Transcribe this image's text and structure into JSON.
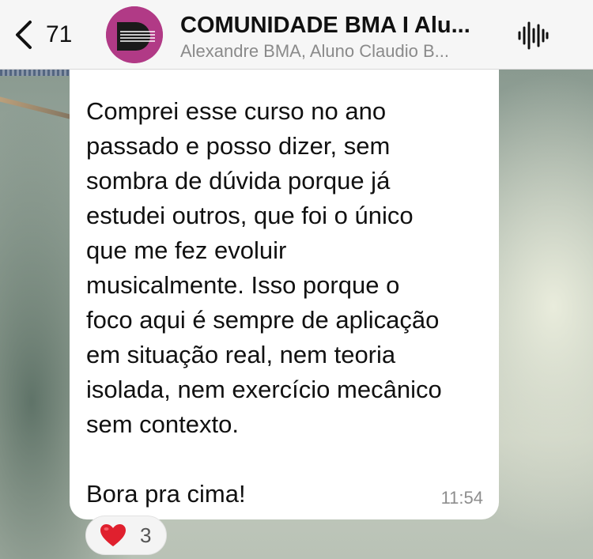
{
  "header": {
    "back_count": "71",
    "title": "COMUNIDADE BMA I Alu...",
    "subtitle": "Alexandre BMA, Aluno Claudio B...",
    "avatar_icon": "group-avatar-logo",
    "action_icon": "audio-waveform-icon"
  },
  "message": {
    "text": "Comprei esse curso no ano\npassado e posso dizer, sem\nsombra de dúvida porque já\nestudei outros, que foi o único\nque me fez evoluir\nmusicalmente. Isso porque o\nfoco aqui é sempre de aplicação\nem situação real, nem teoria\nisolada, nem exercício mecânico\nsem contexto.\n\nBora pra cima!",
    "time": "11:54"
  },
  "reaction": {
    "emoji_icon": "red-heart-icon",
    "count": "3"
  },
  "colors": {
    "avatar": "#b13a86",
    "heart": "#e0202e",
    "bubble": "#ffffff",
    "header_bg": "#f6f6f6"
  }
}
